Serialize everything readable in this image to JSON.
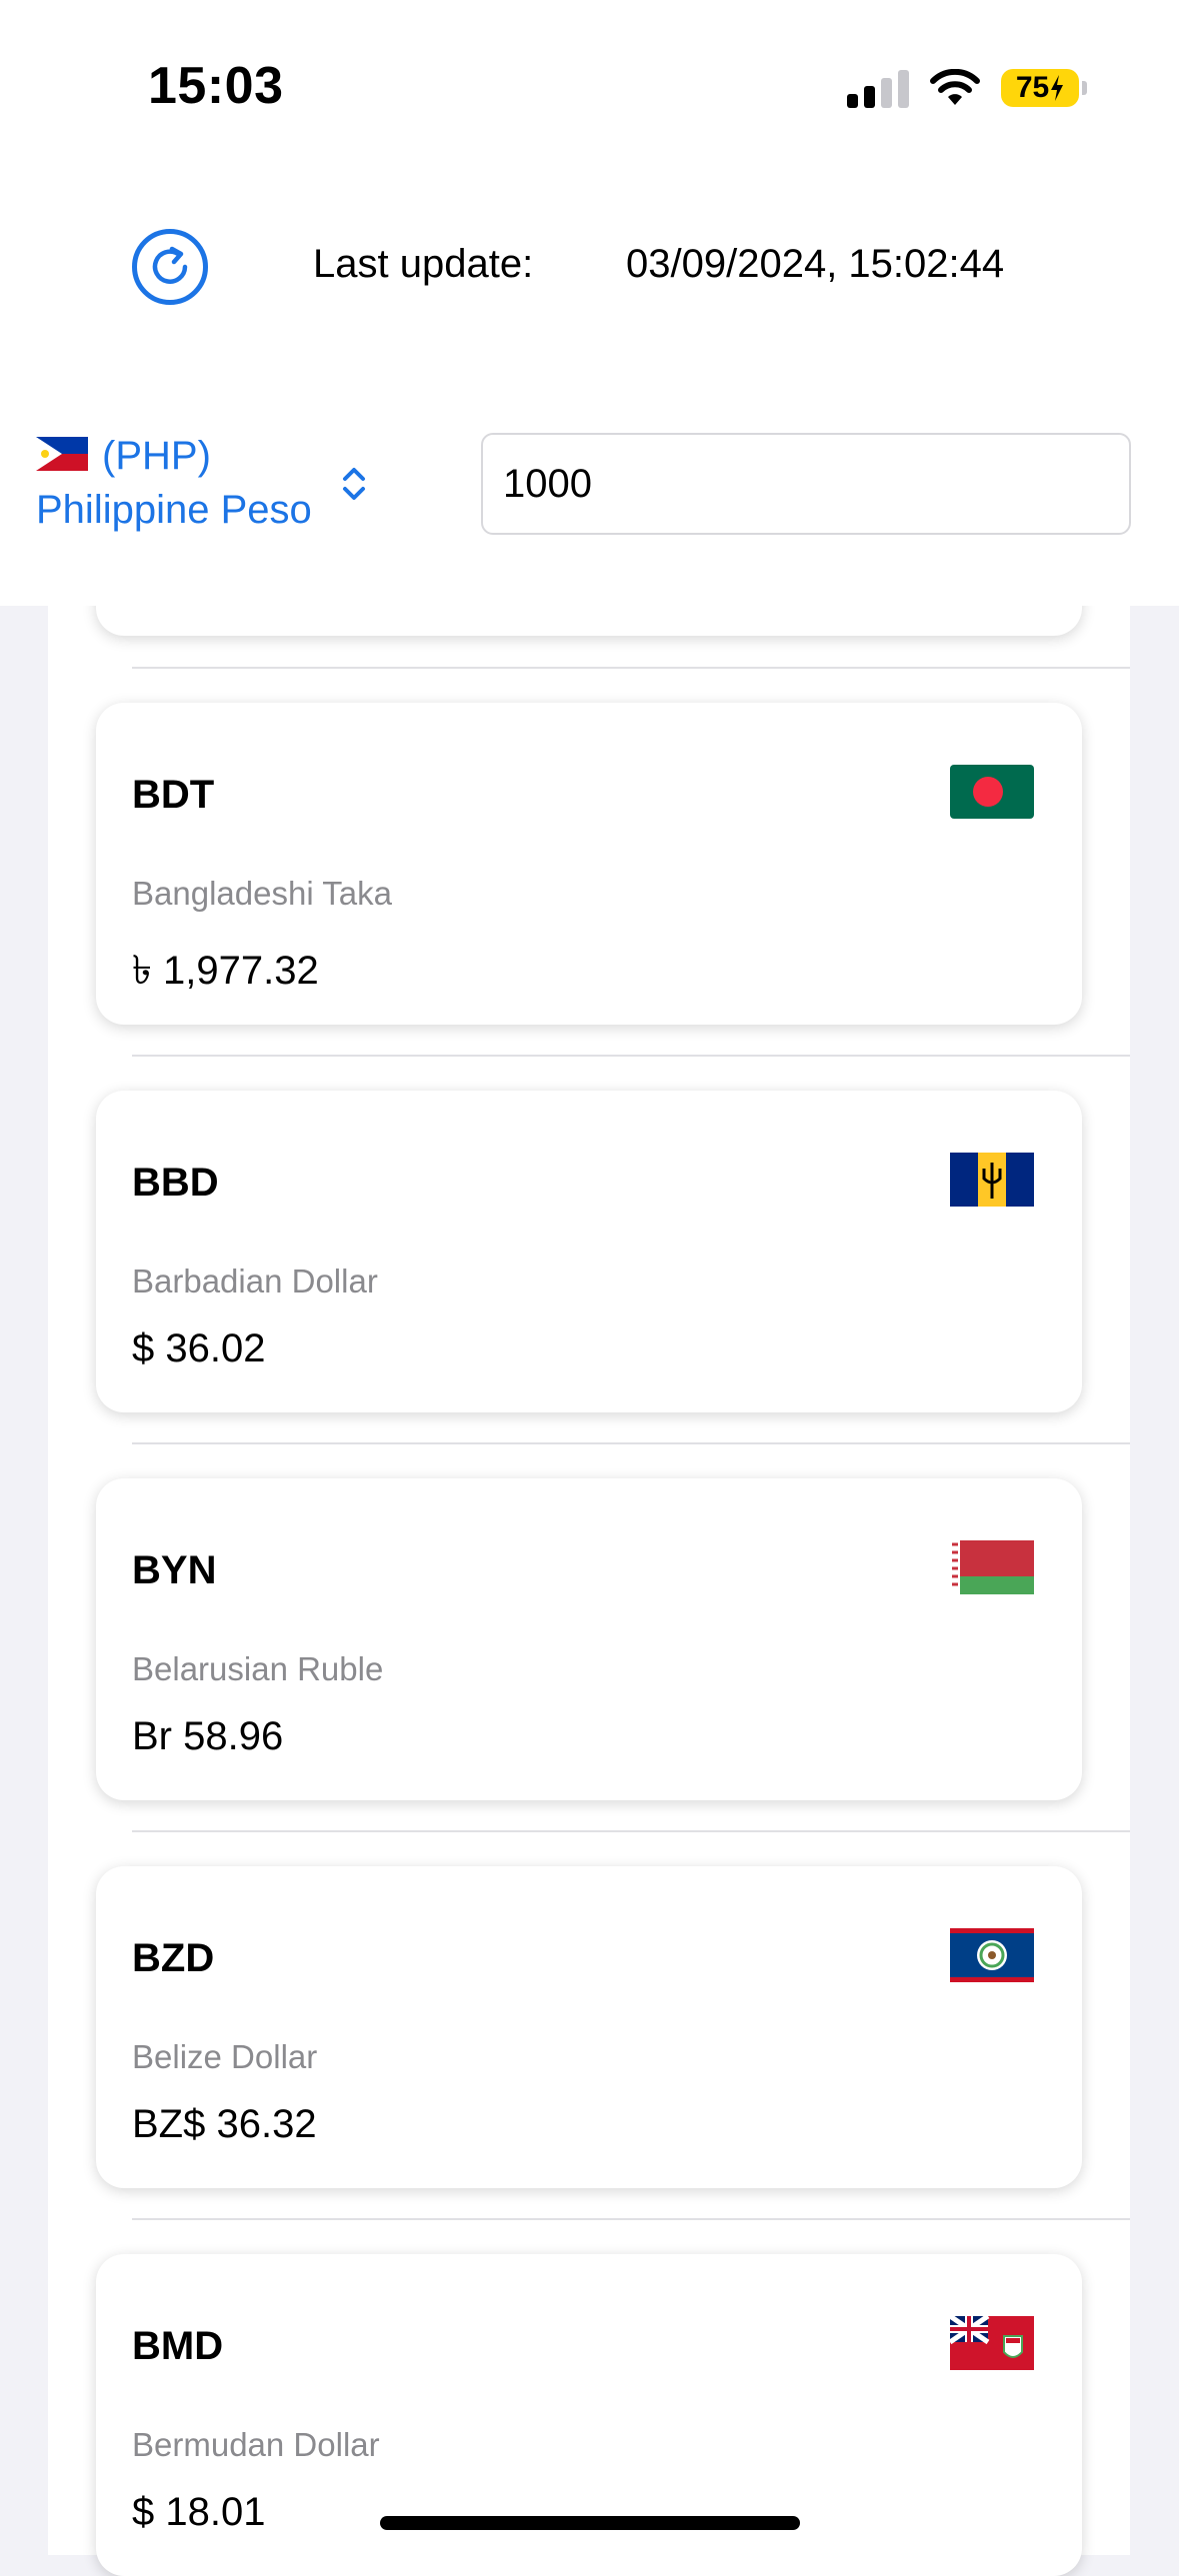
{
  "status_bar": {
    "time": "15:03",
    "battery": "75"
  },
  "header": {
    "last_update_label": "Last update:",
    "last_update_value": "03/09/2024, 15:02:44",
    "refresh_icon": "refresh-icon"
  },
  "base_currency": {
    "code_label": "(PHP)",
    "name": "Philippine Peso",
    "amount": "1000"
  },
  "currencies": [
    {
      "code": "BDT",
      "name": "Bangladeshi Taka",
      "value": "৳ 1,977.32",
      "flag": "bangladesh-flag-icon"
    },
    {
      "code": "BBD",
      "name": "Barbadian Dollar",
      "value": "$ 36.02",
      "flag": "barbados-flag-icon"
    },
    {
      "code": "BYN",
      "name": "Belarusian Ruble",
      "value": "Br 58.96",
      "flag": "belarus-flag-icon"
    },
    {
      "code": "BZD",
      "name": "Belize Dollar",
      "value": "BZ$ 36.32",
      "flag": "belize-flag-icon"
    },
    {
      "code": "BMD",
      "name": "Bermudan Dollar",
      "value": "$ 18.01",
      "flag": "bermuda-flag-icon"
    }
  ],
  "colors": {
    "accent": "#1C74E5",
    "background": "#F2F2F7",
    "secondary_text": "#8A8A8E"
  }
}
